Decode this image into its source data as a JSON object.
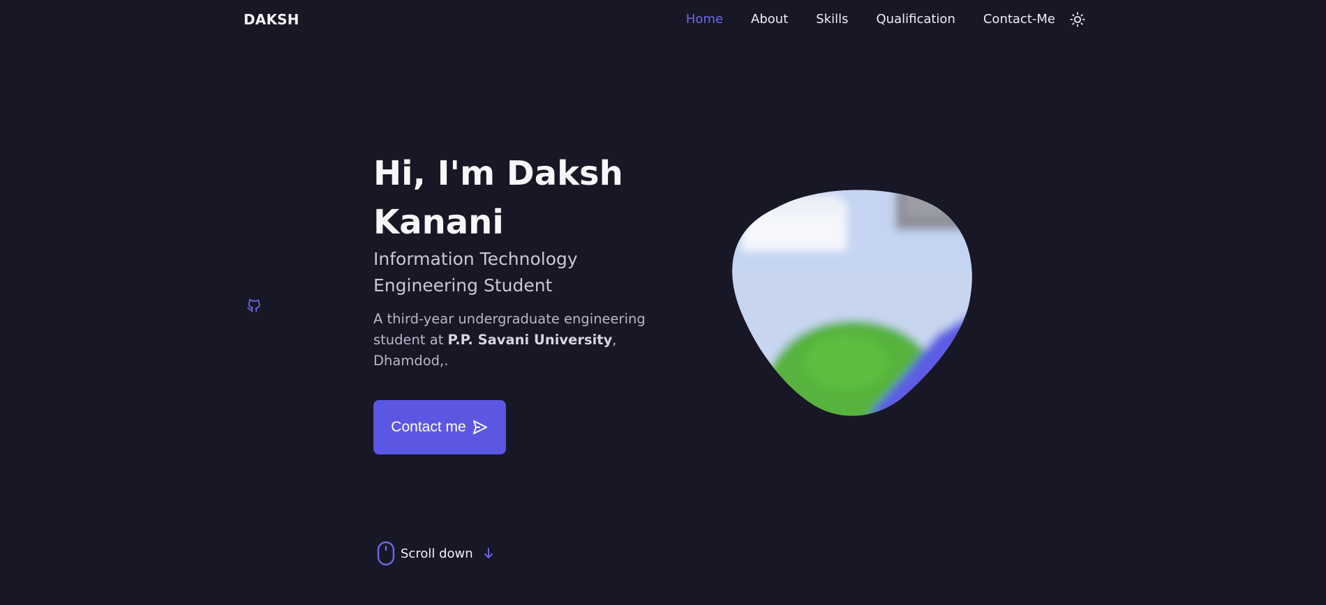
{
  "header": {
    "logo": "DAKSH",
    "nav": [
      {
        "label": "Home",
        "active": true
      },
      {
        "label": "About",
        "active": false
      },
      {
        "label": "Skills",
        "active": false
      },
      {
        "label": "Qualification",
        "active": false
      },
      {
        "label": "Contact-Me",
        "active": false
      }
    ],
    "theme_icon": "sun-icon"
  },
  "social": {
    "icon": "github-icon"
  },
  "hero": {
    "title": "Hi, I'm Daksh Kanani",
    "subtitle": "Information Technology Engineering Student",
    "description_prefix": "A third-year undergraduate engineering student at ",
    "university": "P.P. Savani University",
    "description_suffix": ", Dhamdod,.",
    "button_label": "Contact me",
    "button_icon": "send-icon"
  },
  "scroll": {
    "label": "Scroll down",
    "mouse_icon": "mouse-icon",
    "arrow_icon": "arrow-down-icon"
  },
  "colors": {
    "background": "#181726",
    "accent": "#5b57e2",
    "accent_light": "#6b69e8",
    "text": "#f0f0f5",
    "muted": "#b9b8c8"
  }
}
